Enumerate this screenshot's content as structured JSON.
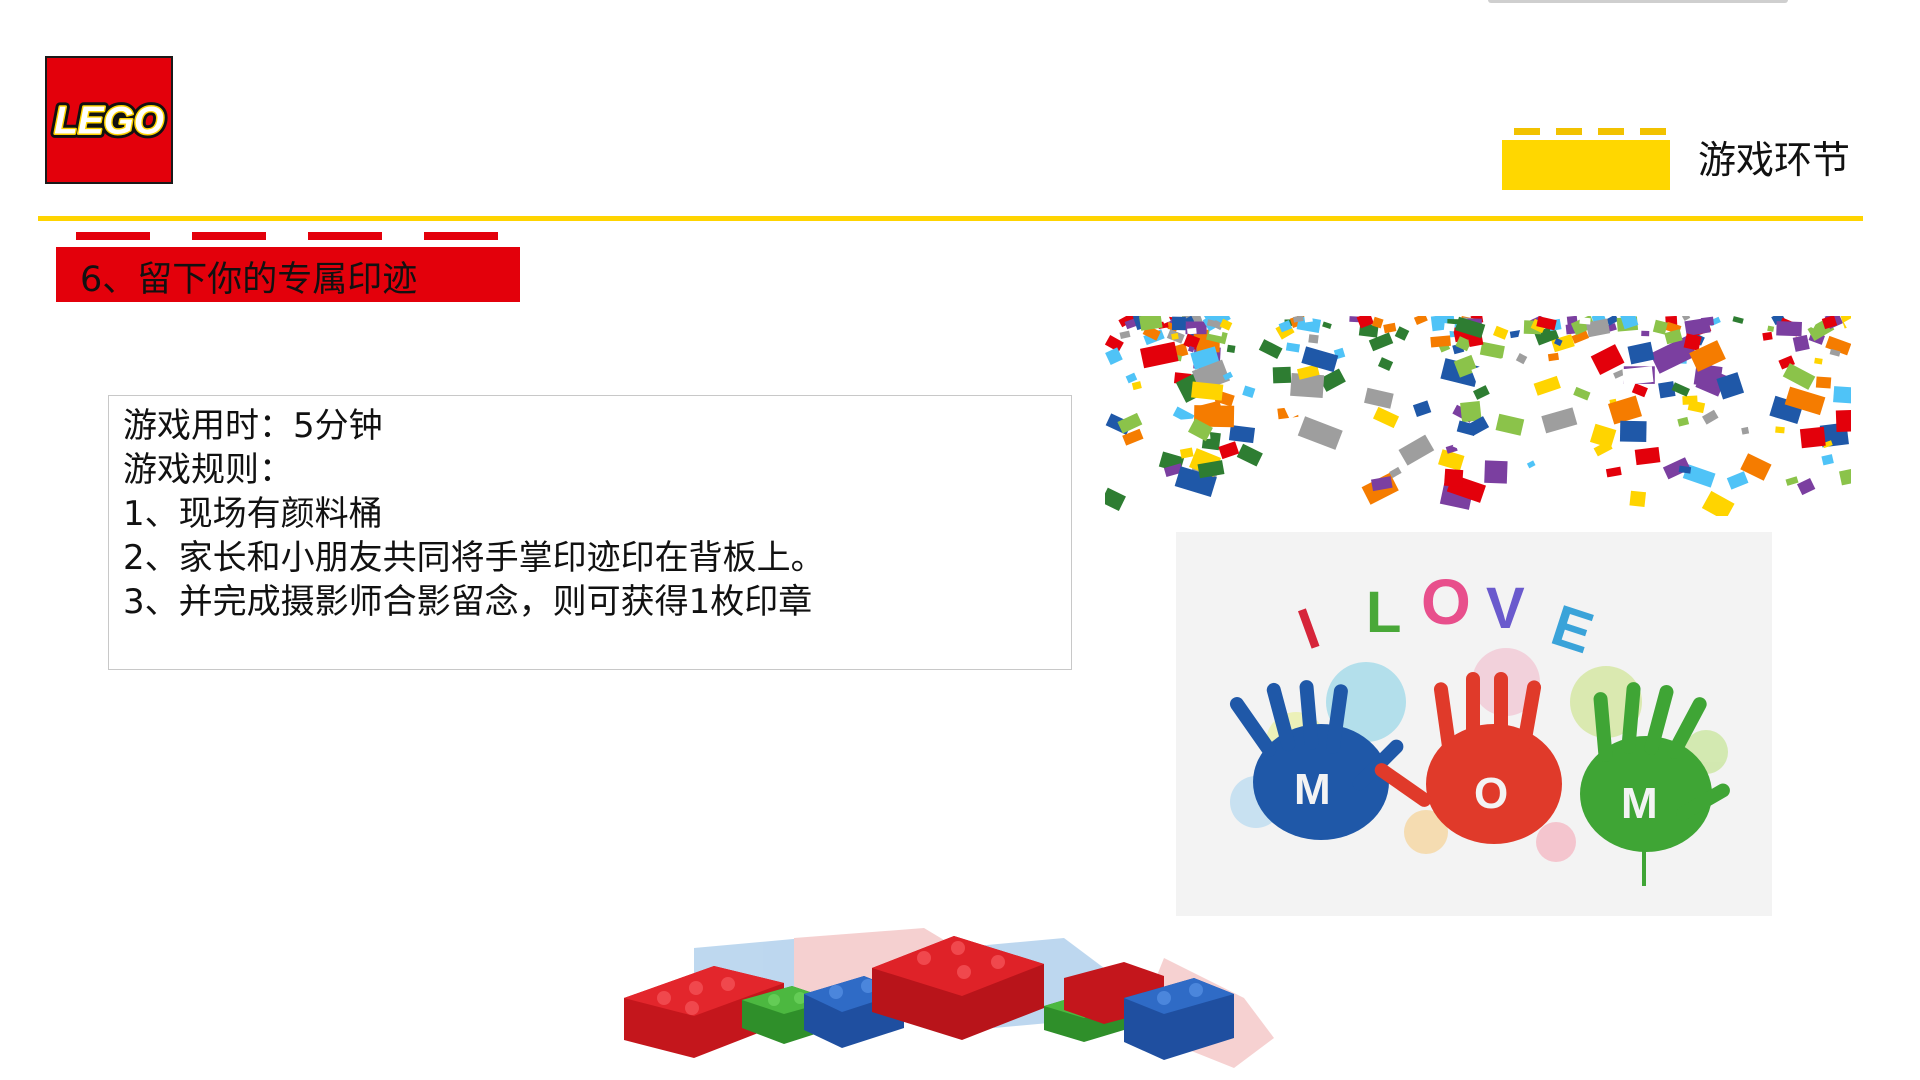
{
  "logo": {
    "text": "LEGO",
    "icon": "lego-logo-icon",
    "color": "#e3000b"
  },
  "header": {
    "title": "游戏环节",
    "brick_color": "#ffd700"
  },
  "divider_color": "#ffd400",
  "section": {
    "title": "6、留下你的专属印迹",
    "brick_color": "#e3000b"
  },
  "rules": {
    "lines": [
      "游戏用时：5分钟",
      "游戏规则：",
      "1、现场有颜料桶",
      "2、家长和小朋友共同将手掌印迹印在背板上。",
      "3、并完成摄影师合影留念，则可获得1枚印章"
    ]
  },
  "images": {
    "love": {
      "letters": [
        "I",
        "L",
        "O",
        "V",
        "E"
      ],
      "palm_letters": [
        "M",
        "O",
        "M"
      ]
    },
    "bricks_rain_icon": "falling-bricks-icon",
    "brick_pile_icon": "brick-pile-icon"
  }
}
